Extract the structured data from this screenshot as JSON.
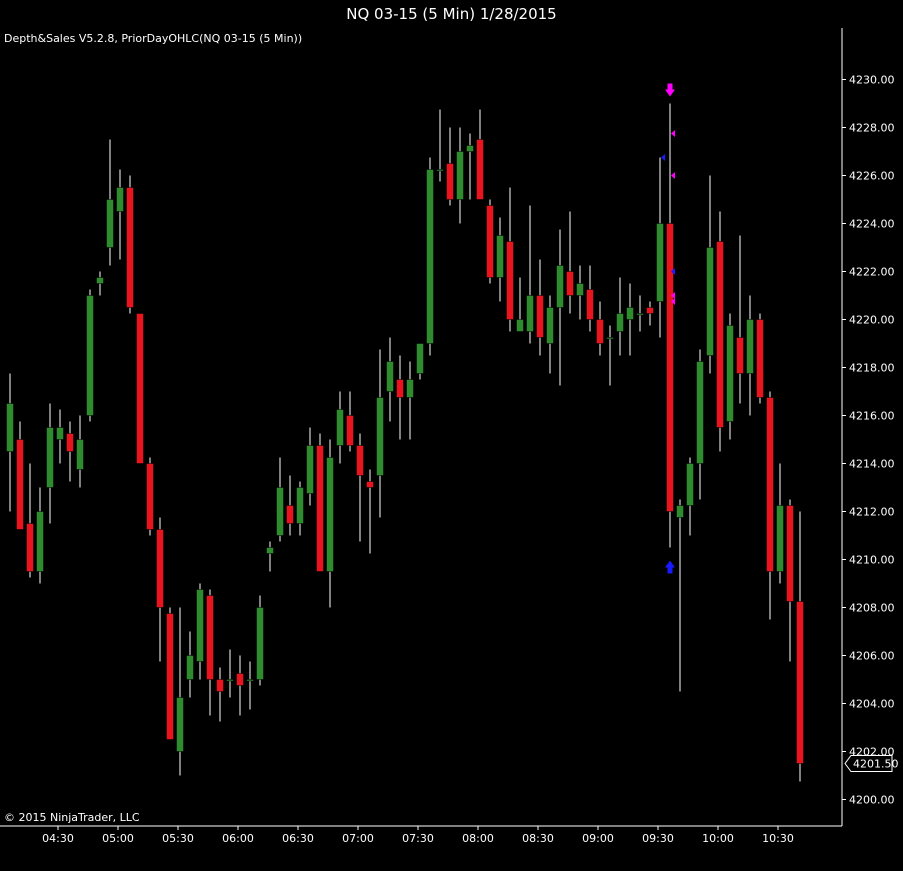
{
  "window": {
    "title": "NQ 03-15 (5 Min)  1/28/2015"
  },
  "chart": {
    "indicator_label": "Depth&Sales V5.2.8, PriorDayOHLC(NQ 03-15 (5 Min))",
    "copyright": "© 2015 NinjaTrader, LLC",
    "last_price_label": "4201.50"
  },
  "colors": {
    "background": "#000000",
    "up_candle": "#2e8b2e",
    "down_candle": "#e8141e",
    "wick": "#ffffff",
    "axis": "#ffffff",
    "marker_magenta": "#ff00ff",
    "marker_blue": "#1a1aff"
  },
  "chart_data": {
    "type": "candlestick",
    "symbol": "NQ 03-15",
    "interval": "5 Min",
    "date": "1/28/2015",
    "ylim": [
      4199.5,
      4231.0
    ],
    "y_ticks": [
      "4200.00",
      "4202.00",
      "4204.00",
      "4206.00",
      "4208.00",
      "4210.00",
      "4212.00",
      "4214.00",
      "4216.00",
      "4218.00",
      "4220.00",
      "4222.00",
      "4224.00",
      "4226.00",
      "4228.00",
      "4230.00"
    ],
    "x_ticks": [
      {
        "label": "04:30",
        "index": 5
      },
      {
        "label": "05:00",
        "index": 11
      },
      {
        "label": "05:30",
        "index": 17
      },
      {
        "label": "06:00",
        "index": 23
      },
      {
        "label": "06:30",
        "index": 29
      },
      {
        "label": "07:00",
        "index": 35
      },
      {
        "label": "07:30",
        "index": 41
      },
      {
        "label": "08:00",
        "index": 47
      },
      {
        "label": "08:30",
        "index": 53
      },
      {
        "label": "09:00",
        "index": 59
      },
      {
        "label": "09:30",
        "index": 65
      },
      {
        "label": "10:00",
        "index": 71
      },
      {
        "label": "10:30",
        "index": 77
      }
    ],
    "candles": [
      {
        "o": 4214.5,
        "h": 4217.75,
        "l": 4212.0,
        "c": 4216.5
      },
      {
        "o": 4215.0,
        "h": 4215.75,
        "l": 4211.25,
        "c": 4211.25
      },
      {
        "o": 4211.5,
        "h": 4214.0,
        "l": 4209.25,
        "c": 4209.5
      },
      {
        "o": 4209.5,
        "h": 4213.0,
        "l": 4209.0,
        "c": 4212.0
      },
      {
        "o": 4213.0,
        "h": 4216.5,
        "l": 4211.5,
        "c": 4215.5
      },
      {
        "o": 4215.0,
        "h": 4216.25,
        "l": 4214.0,
        "c": 4215.5
      },
      {
        "o": 4215.25,
        "h": 4215.75,
        "l": 4213.25,
        "c": 4214.5
      },
      {
        "o": 4213.75,
        "h": 4216.0,
        "l": 4213.0,
        "c": 4215.0
      },
      {
        "o": 4216.0,
        "h": 4221.25,
        "l": 4215.75,
        "c": 4221.0
      },
      {
        "o": 4221.5,
        "h": 4222.0,
        "l": 4221.0,
        "c": 4221.75
      },
      {
        "o": 4223.0,
        "h": 4227.5,
        "l": 4222.25,
        "c": 4225.0
      },
      {
        "o": 4224.5,
        "h": 4226.25,
        "l": 4222.5,
        "c": 4225.5
      },
      {
        "o": 4225.5,
        "h": 4226.0,
        "l": 4220.25,
        "c": 4220.5
      },
      {
        "o": 4220.25,
        "h": 4220.25,
        "l": 4214.0,
        "c": 4214.0
      },
      {
        "o": 4214.0,
        "h": 4214.25,
        "l": 4211.0,
        "c": 4211.25
      },
      {
        "o": 4211.25,
        "h": 4211.75,
        "l": 4205.75,
        "c": 4208.0
      },
      {
        "o": 4207.75,
        "h": 4208.0,
        "l": 4202.5,
        "c": 4202.5
      },
      {
        "o": 4202.0,
        "h": 4208.0,
        "l": 4201.0,
        "c": 4204.25
      },
      {
        "o": 4205.0,
        "h": 4207.0,
        "l": 4204.25,
        "c": 4206.0
      },
      {
        "o": 4205.75,
        "h": 4209.0,
        "l": 4205.0,
        "c": 4208.75
      },
      {
        "o": 4208.5,
        "h": 4208.75,
        "l": 4203.5,
        "c": 4205.0
      },
      {
        "o": 4205.0,
        "h": 4205.5,
        "l": 4203.25,
        "c": 4204.5
      },
      {
        "o": 4205.0,
        "h": 4206.25,
        "l": 4204.25,
        "c": 4205.0
      },
      {
        "o": 4205.25,
        "h": 4206.0,
        "l": 4203.5,
        "c": 4204.75
      },
      {
        "o": 4205.0,
        "h": 4205.75,
        "l": 4203.75,
        "c": 4205.0
      },
      {
        "o": 4205.0,
        "h": 4208.5,
        "l": 4204.75,
        "c": 4208.0
      },
      {
        "o": 4210.25,
        "h": 4210.75,
        "l": 4209.5,
        "c": 4210.5
      },
      {
        "o": 4211.0,
        "h": 4214.25,
        "l": 4210.75,
        "c": 4213.0
      },
      {
        "o": 4212.25,
        "h": 4213.5,
        "l": 4211.0,
        "c": 4211.5
      },
      {
        "o": 4211.5,
        "h": 4213.25,
        "l": 4211.0,
        "c": 4213.0
      },
      {
        "o": 4212.75,
        "h": 4215.5,
        "l": 4212.25,
        "c": 4214.75
      },
      {
        "o": 4214.75,
        "h": 4215.25,
        "l": 4209.5,
        "c": 4209.5
      },
      {
        "o": 4209.5,
        "h": 4215.0,
        "l": 4208.0,
        "c": 4214.25
      },
      {
        "o": 4214.75,
        "h": 4217.0,
        "l": 4214.0,
        "c": 4216.25
      },
      {
        "o": 4216.0,
        "h": 4217.0,
        "l": 4214.5,
        "c": 4214.75
      },
      {
        "o": 4214.75,
        "h": 4215.25,
        "l": 4210.75,
        "c": 4213.5
      },
      {
        "o": 4213.25,
        "h": 4213.75,
        "l": 4210.25,
        "c": 4213.0
      },
      {
        "o": 4213.5,
        "h": 4218.75,
        "l": 4211.75,
        "c": 4216.75
      },
      {
        "o": 4217.0,
        "h": 4219.25,
        "l": 4215.75,
        "c": 4218.25
      },
      {
        "o": 4217.5,
        "h": 4218.5,
        "l": 4215.0,
        "c": 4216.75
      },
      {
        "o": 4216.75,
        "h": 4218.25,
        "l": 4215.0,
        "c": 4217.5
      },
      {
        "o": 4217.75,
        "h": 4219.0,
        "l": 4217.5,
        "c": 4219.0
      },
      {
        "o": 4219.0,
        "h": 4226.75,
        "l": 4218.5,
        "c": 4226.25
      },
      {
        "o": 4226.25,
        "h": 4228.75,
        "l": 4225.75,
        "c": 4226.25
      },
      {
        "o": 4226.5,
        "h": 4228.0,
        "l": 4224.75,
        "c": 4225.0
      },
      {
        "o": 4225.0,
        "h": 4228.0,
        "l": 4224.0,
        "c": 4227.0
      },
      {
        "o": 4227.0,
        "h": 4227.75,
        "l": 4225.0,
        "c": 4227.25
      },
      {
        "o": 4227.5,
        "h": 4228.75,
        "l": 4225.0,
        "c": 4225.0
      },
      {
        "o": 4224.75,
        "h": 4225.0,
        "l": 4221.5,
        "c": 4221.75
      },
      {
        "o": 4221.75,
        "h": 4224.25,
        "l": 4220.75,
        "c": 4223.5
      },
      {
        "o": 4223.25,
        "h": 4225.5,
        "l": 4219.5,
        "c": 4220.0
      },
      {
        "o": 4219.5,
        "h": 4221.75,
        "l": 4219.5,
        "c": 4220.0
      },
      {
        "o": 4219.5,
        "h": 4224.75,
        "l": 4219.0,
        "c": 4221.0
      },
      {
        "o": 4221.0,
        "h": 4222.5,
        "l": 4218.5,
        "c": 4219.25
      },
      {
        "o": 4219.0,
        "h": 4221.0,
        "l": 4217.75,
        "c": 4220.5
      },
      {
        "o": 4220.5,
        "h": 4223.75,
        "l": 4217.25,
        "c": 4222.25
      },
      {
        "o": 4222.0,
        "h": 4224.5,
        "l": 4220.25,
        "c": 4221.0
      },
      {
        "o": 4221.0,
        "h": 4222.25,
        "l": 4220.0,
        "c": 4221.5
      },
      {
        "o": 4221.25,
        "h": 4222.25,
        "l": 4219.5,
        "c": 4220.0
      },
      {
        "o": 4220.0,
        "h": 4220.75,
        "l": 4218.5,
        "c": 4219.0
      },
      {
        "o": 4219.25,
        "h": 4219.75,
        "l": 4217.25,
        "c": 4219.25
      },
      {
        "o": 4219.5,
        "h": 4221.75,
        "l": 4218.5,
        "c": 4220.25
      },
      {
        "o": 4220.0,
        "h": 4221.5,
        "l": 4218.5,
        "c": 4220.5
      },
      {
        "o": 4220.25,
        "h": 4221.0,
        "l": 4219.5,
        "c": 4220.25
      },
      {
        "o": 4220.5,
        "h": 4220.75,
        "l": 4219.75,
        "c": 4220.25
      },
      {
        "o": 4220.75,
        "h": 4226.75,
        "l": 4219.25,
        "c": 4224.0
      },
      {
        "o": 4224.0,
        "h": 4229.0,
        "l": 4210.5,
        "c": 4212.0
      },
      {
        "o": 4211.75,
        "h": 4212.5,
        "l": 4204.5,
        "c": 4212.25
      },
      {
        "o": 4212.25,
        "h": 4214.25,
        "l": 4211.0,
        "c": 4214.0
      },
      {
        "o": 4214.0,
        "h": 4218.75,
        "l": 4212.5,
        "c": 4218.25
      },
      {
        "o": 4218.5,
        "h": 4226.0,
        "l": 4217.75,
        "c": 4223.0
      },
      {
        "o": 4223.25,
        "h": 4224.5,
        "l": 4214.5,
        "c": 4215.5
      },
      {
        "o": 4215.75,
        "h": 4220.25,
        "l": 4215.0,
        "c": 4219.75
      },
      {
        "o": 4219.25,
        "h": 4223.5,
        "l": 4216.5,
        "c": 4217.75
      },
      {
        "o": 4217.75,
        "h": 4221.0,
        "l": 4216.0,
        "c": 4220.0
      },
      {
        "o": 4220.0,
        "h": 4220.25,
        "l": 4216.5,
        "c": 4216.75
      },
      {
        "o": 4216.75,
        "h": 4217.0,
        "l": 4207.5,
        "c": 4209.5
      },
      {
        "o": 4209.5,
        "h": 4214.0,
        "l": 4209.0,
        "c": 4212.25
      },
      {
        "o": 4212.25,
        "h": 4212.5,
        "l": 4205.75,
        "c": 4208.25
      },
      {
        "o": 4208.25,
        "h": 4212.0,
        "l": 4200.75,
        "c": 4201.5
      }
    ],
    "markers": [
      {
        "type": "down-arrow",
        "index": 66,
        "price": 4229.5,
        "color": "magenta"
      },
      {
        "type": "up-arrow",
        "index": 66,
        "price": 4209.75,
        "color": "blue"
      },
      {
        "type": "left-triangle",
        "index": 66,
        "price": 4227.75,
        "color": "magenta"
      },
      {
        "type": "left-triangle",
        "index": 66,
        "price": 4226.0,
        "color": "magenta"
      },
      {
        "type": "left-triangle",
        "index": 66,
        "price": 4221.0,
        "color": "magenta"
      },
      {
        "type": "left-triangle",
        "index": 66,
        "price": 4220.75,
        "color": "magenta"
      },
      {
        "type": "left-triangle",
        "index": 65,
        "price": 4226.75,
        "color": "blue"
      },
      {
        "type": "left-triangle",
        "index": 66,
        "price": 4222.0,
        "color": "blue"
      }
    ],
    "last_price": 4201.5
  }
}
